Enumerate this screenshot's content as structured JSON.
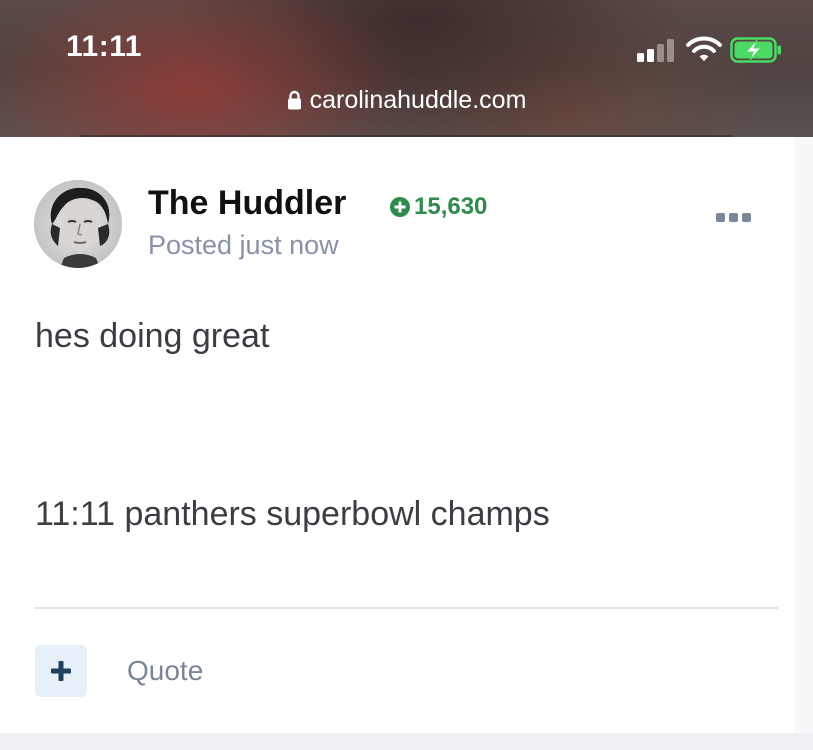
{
  "status_bar": {
    "time": "11:11",
    "icons": [
      "cellular-signal-icon",
      "wifi-icon",
      "battery-charging-icon"
    ],
    "signal_bars_active": 2,
    "signal_bars_total": 4
  },
  "address_bar": {
    "domain": "carolinahuddle.com",
    "icon": "lock-icon"
  },
  "post": {
    "author": "The Huddler",
    "reputation": "15,630",
    "reputation_icon": "plus-circle-icon",
    "posted": "Posted just now",
    "menu_icon": "ellipsis-icon",
    "content_lines": [
      "hes doing great",
      "11:11 panthers superbowl champs"
    ]
  },
  "actions": {
    "add_icon": "plus-icon",
    "quote_label": "Quote"
  },
  "colors": {
    "reputation_green": "#2f8a4e",
    "meta_gray": "#8792a8",
    "text_dark": "#3a3d42",
    "button_bg": "#e7f0f8",
    "button_icon": "#1f3f5f"
  }
}
